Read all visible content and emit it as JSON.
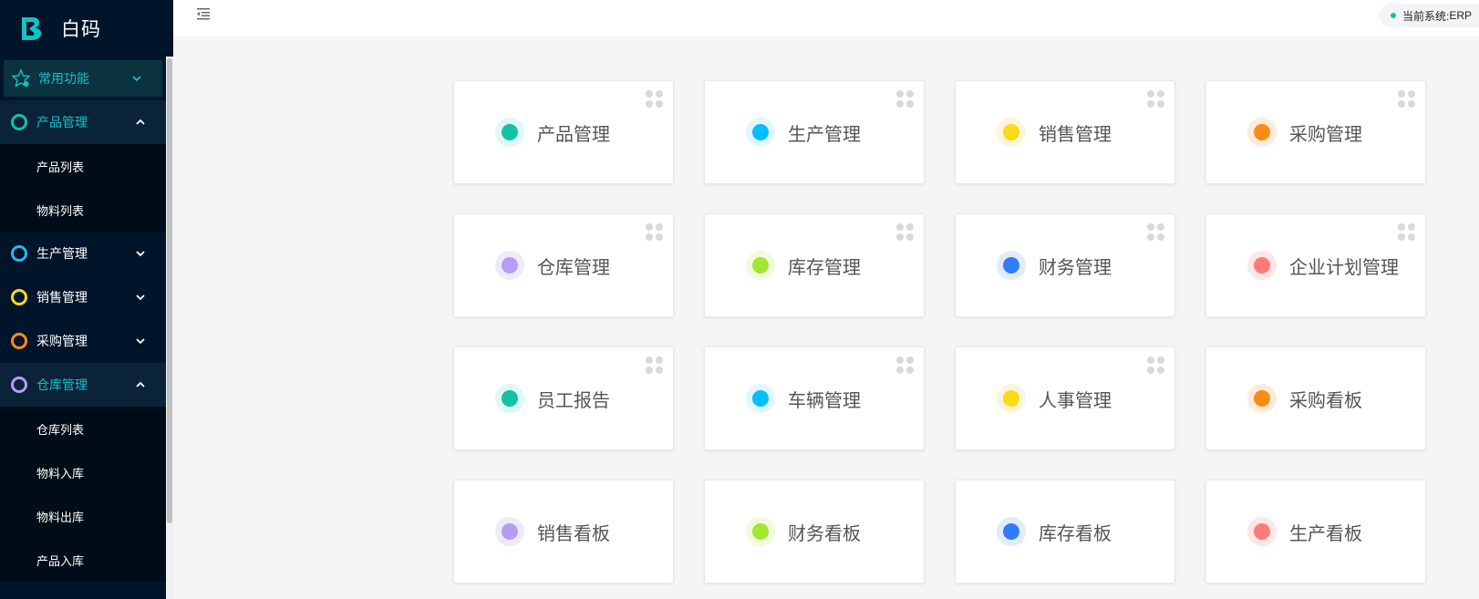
{
  "app": {
    "name": "白码"
  },
  "header": {
    "system_label": "当前系统:",
    "system_value": "ERP"
  },
  "colors": {
    "teal": "#13c2c2",
    "sky": "#00bfff",
    "yellow": "#fadb14",
    "orange": "#fa8c16",
    "purple": "#b59cf5",
    "lime": "#a0e632",
    "blue": "#2f7cf6",
    "salmon": "#ff7b7b"
  },
  "menu": {
    "favorites": {
      "label": "常用功能",
      "icon": "star-icon"
    },
    "groups": [
      {
        "label": "产品管理",
        "ring": "#13c2a3",
        "open": true,
        "items": [
          "产品列表",
          "物料列表"
        ]
      },
      {
        "label": "生产管理",
        "ring": "#29b6f6",
        "open": false,
        "items": []
      },
      {
        "label": "销售管理",
        "ring": "#fadb14",
        "open": false,
        "items": []
      },
      {
        "label": "采购管理",
        "ring": "#fa8c16",
        "open": false,
        "items": []
      },
      {
        "label": "仓库管理",
        "ring": "#b59cf5",
        "open": true,
        "items": [
          "仓库列表",
          "物料入库",
          "物料出库",
          "产品入库"
        ]
      }
    ]
  },
  "cards": [
    {
      "title": "产品管理",
      "color": "#13c2a3",
      "bg": "#e0f7f3",
      "drag": true
    },
    {
      "title": "生产管理",
      "color": "#00bfff",
      "bg": "#e3f6fd",
      "drag": true
    },
    {
      "title": "销售管理",
      "color": "#fadb14",
      "bg": "#fdf4dc",
      "drag": true
    },
    {
      "title": "采购管理",
      "color": "#fa8c16",
      "bg": "#fdeadb",
      "drag": true
    },
    {
      "title": "仓库管理",
      "color": "#b59cf5",
      "bg": "#efe9fc",
      "drag": true
    },
    {
      "title": "库存管理",
      "color": "#a0e632",
      "bg": "#f0fadd",
      "drag": true
    },
    {
      "title": "财务管理",
      "color": "#2f7cf6",
      "bg": "#e1ebfc",
      "drag": true
    },
    {
      "title": "企业计划管理",
      "color": "#ff7b7b",
      "bg": "#fde6e6",
      "drag": true
    },
    {
      "title": "员工报告",
      "color": "#13c2a3",
      "bg": "#e0f7f3",
      "drag": true
    },
    {
      "title": "车辆管理",
      "color": "#00bfff",
      "bg": "#e3f6fd",
      "drag": true
    },
    {
      "title": "人事管理",
      "color": "#fadb14",
      "bg": "#fdf4dc",
      "drag": true
    },
    {
      "title": "采购看板",
      "color": "#fa8c16",
      "bg": "#fdeadb",
      "drag": false
    },
    {
      "title": "销售看板",
      "color": "#b59cf5",
      "bg": "#efe9fc",
      "drag": false
    },
    {
      "title": "财务看板",
      "color": "#a0e632",
      "bg": "#f0fadd",
      "drag": false
    },
    {
      "title": "库存看板",
      "color": "#2f7cf6",
      "bg": "#e1ebfc",
      "drag": false
    },
    {
      "title": "生产看板",
      "color": "#ff7b7b",
      "bg": "#fde6e6",
      "drag": false
    }
  ]
}
